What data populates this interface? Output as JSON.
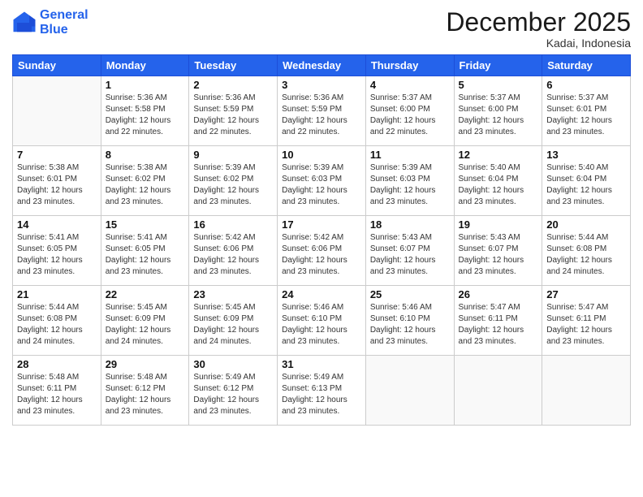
{
  "logo": {
    "line1": "General",
    "line2": "Blue"
  },
  "title": "December 2025",
  "location": "Kadai, Indonesia",
  "days": [
    "Sunday",
    "Monday",
    "Tuesday",
    "Wednesday",
    "Thursday",
    "Friday",
    "Saturday"
  ],
  "weeks": [
    [
      {
        "day": "",
        "content": ""
      },
      {
        "day": "1",
        "content": "Sunrise: 5:36 AM\nSunset: 5:58 PM\nDaylight: 12 hours\nand 22 minutes."
      },
      {
        "day": "2",
        "content": "Sunrise: 5:36 AM\nSunset: 5:59 PM\nDaylight: 12 hours\nand 22 minutes."
      },
      {
        "day": "3",
        "content": "Sunrise: 5:36 AM\nSunset: 5:59 PM\nDaylight: 12 hours\nand 22 minutes."
      },
      {
        "day": "4",
        "content": "Sunrise: 5:37 AM\nSunset: 6:00 PM\nDaylight: 12 hours\nand 22 minutes."
      },
      {
        "day": "5",
        "content": "Sunrise: 5:37 AM\nSunset: 6:00 PM\nDaylight: 12 hours\nand 23 minutes."
      },
      {
        "day": "6",
        "content": "Sunrise: 5:37 AM\nSunset: 6:01 PM\nDaylight: 12 hours\nand 23 minutes."
      }
    ],
    [
      {
        "day": "7",
        "content": "Sunrise: 5:38 AM\nSunset: 6:01 PM\nDaylight: 12 hours\nand 23 minutes."
      },
      {
        "day": "8",
        "content": "Sunrise: 5:38 AM\nSunset: 6:02 PM\nDaylight: 12 hours\nand 23 minutes."
      },
      {
        "day": "9",
        "content": "Sunrise: 5:39 AM\nSunset: 6:02 PM\nDaylight: 12 hours\nand 23 minutes."
      },
      {
        "day": "10",
        "content": "Sunrise: 5:39 AM\nSunset: 6:03 PM\nDaylight: 12 hours\nand 23 minutes."
      },
      {
        "day": "11",
        "content": "Sunrise: 5:39 AM\nSunset: 6:03 PM\nDaylight: 12 hours\nand 23 minutes."
      },
      {
        "day": "12",
        "content": "Sunrise: 5:40 AM\nSunset: 6:04 PM\nDaylight: 12 hours\nand 23 minutes."
      },
      {
        "day": "13",
        "content": "Sunrise: 5:40 AM\nSunset: 6:04 PM\nDaylight: 12 hours\nand 23 minutes."
      }
    ],
    [
      {
        "day": "14",
        "content": "Sunrise: 5:41 AM\nSunset: 6:05 PM\nDaylight: 12 hours\nand 23 minutes."
      },
      {
        "day": "15",
        "content": "Sunrise: 5:41 AM\nSunset: 6:05 PM\nDaylight: 12 hours\nand 23 minutes."
      },
      {
        "day": "16",
        "content": "Sunrise: 5:42 AM\nSunset: 6:06 PM\nDaylight: 12 hours\nand 23 minutes."
      },
      {
        "day": "17",
        "content": "Sunrise: 5:42 AM\nSunset: 6:06 PM\nDaylight: 12 hours\nand 23 minutes."
      },
      {
        "day": "18",
        "content": "Sunrise: 5:43 AM\nSunset: 6:07 PM\nDaylight: 12 hours\nand 23 minutes."
      },
      {
        "day": "19",
        "content": "Sunrise: 5:43 AM\nSunset: 6:07 PM\nDaylight: 12 hours\nand 23 minutes."
      },
      {
        "day": "20",
        "content": "Sunrise: 5:44 AM\nSunset: 6:08 PM\nDaylight: 12 hours\nand 24 minutes."
      }
    ],
    [
      {
        "day": "21",
        "content": "Sunrise: 5:44 AM\nSunset: 6:08 PM\nDaylight: 12 hours\nand 24 minutes."
      },
      {
        "day": "22",
        "content": "Sunrise: 5:45 AM\nSunset: 6:09 PM\nDaylight: 12 hours\nand 24 minutes."
      },
      {
        "day": "23",
        "content": "Sunrise: 5:45 AM\nSunset: 6:09 PM\nDaylight: 12 hours\nand 24 minutes."
      },
      {
        "day": "24",
        "content": "Sunrise: 5:46 AM\nSunset: 6:10 PM\nDaylight: 12 hours\nand 23 minutes."
      },
      {
        "day": "25",
        "content": "Sunrise: 5:46 AM\nSunset: 6:10 PM\nDaylight: 12 hours\nand 23 minutes."
      },
      {
        "day": "26",
        "content": "Sunrise: 5:47 AM\nSunset: 6:11 PM\nDaylight: 12 hours\nand 23 minutes."
      },
      {
        "day": "27",
        "content": "Sunrise: 5:47 AM\nSunset: 6:11 PM\nDaylight: 12 hours\nand 23 minutes."
      }
    ],
    [
      {
        "day": "28",
        "content": "Sunrise: 5:48 AM\nSunset: 6:11 PM\nDaylight: 12 hours\nand 23 minutes."
      },
      {
        "day": "29",
        "content": "Sunrise: 5:48 AM\nSunset: 6:12 PM\nDaylight: 12 hours\nand 23 minutes."
      },
      {
        "day": "30",
        "content": "Sunrise: 5:49 AM\nSunset: 6:12 PM\nDaylight: 12 hours\nand 23 minutes."
      },
      {
        "day": "31",
        "content": "Sunrise: 5:49 AM\nSunset: 6:13 PM\nDaylight: 12 hours\nand 23 minutes."
      },
      {
        "day": "",
        "content": ""
      },
      {
        "day": "",
        "content": ""
      },
      {
        "day": "",
        "content": ""
      }
    ]
  ]
}
